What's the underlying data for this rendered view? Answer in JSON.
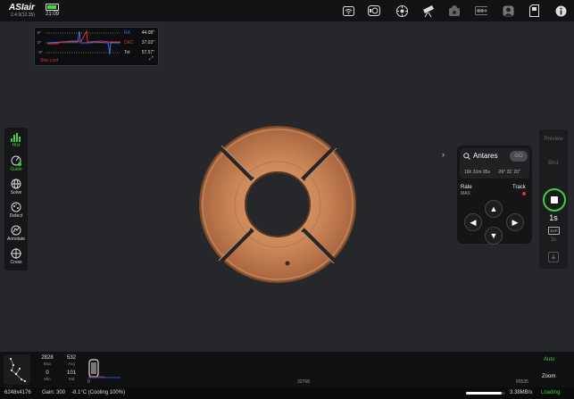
{
  "app": {
    "logo": "ASIair",
    "version": "2.4.9(12.35)",
    "time": "21:09"
  },
  "topbar_icons": [
    "wifi-icon",
    "camera-icon",
    "focuser-icon",
    "telescope-icon",
    "guide-camera-icon",
    "filter-wheel-icon",
    "user-icon",
    "sd-card-icon",
    "info-icon"
  ],
  "guide_graph": {
    "y_labels": [
      "8″",
      "0″",
      "-8″"
    ],
    "ra_label": "RA",
    "ra_value": "44.08″",
    "dec_label": "DEC",
    "dec_value": "37.03″",
    "tot_label": "Tot",
    "tot_value": "57.57″",
    "status": "Star Lost",
    "colors": {
      "ra": "#3b6cf0",
      "dec": "#e03030"
    }
  },
  "left_tools": [
    {
      "label": "Hist",
      "icon": "histogram-icon",
      "active": true
    },
    {
      "label": "Guide",
      "icon": "guide-icon",
      "active": true
    },
    {
      "label": "Solve",
      "icon": "solve-icon",
      "active": false
    },
    {
      "label": "Detect",
      "icon": "detect-icon",
      "active": false
    },
    {
      "label": "Annotate",
      "icon": "annotate-icon",
      "active": false
    },
    {
      "label": "Cross",
      "icon": "crosshair-icon",
      "active": false
    }
  ],
  "goto": {
    "target": "Antares",
    "go_label": "GO",
    "ra": "16h 31m 05s",
    "dec": "-26° 31' 20\"",
    "rate_label": "Rate",
    "rate_value": "MAX",
    "track_label": "Track"
  },
  "capture": {
    "mode_preview": "Preview",
    "bin": "Bin1",
    "exposure": "1s",
    "exp_badge": "EXP",
    "interval": "3s"
  },
  "histogram": {
    "max_value": "2828",
    "max_label": "Max",
    "avg_value": "532",
    "avg_label": "Avg",
    "min_value": "0",
    "min_label": "Min",
    "std_value": "101",
    "std_label": "Std",
    "axis_left": "0",
    "axis_mid": "32768",
    "axis_right": "65535",
    "auto_label": "Auto",
    "zoom_label": "Zoom"
  },
  "status": {
    "resolution": "6248x4176",
    "gain": "Gain: 300",
    "temp": "-8.1°C (Cooling 100%)",
    "speed": "3.38MB/s",
    "loading": "Loading"
  },
  "colors": {
    "accent": "#3ecf3e",
    "ring": "#c9875a"
  }
}
